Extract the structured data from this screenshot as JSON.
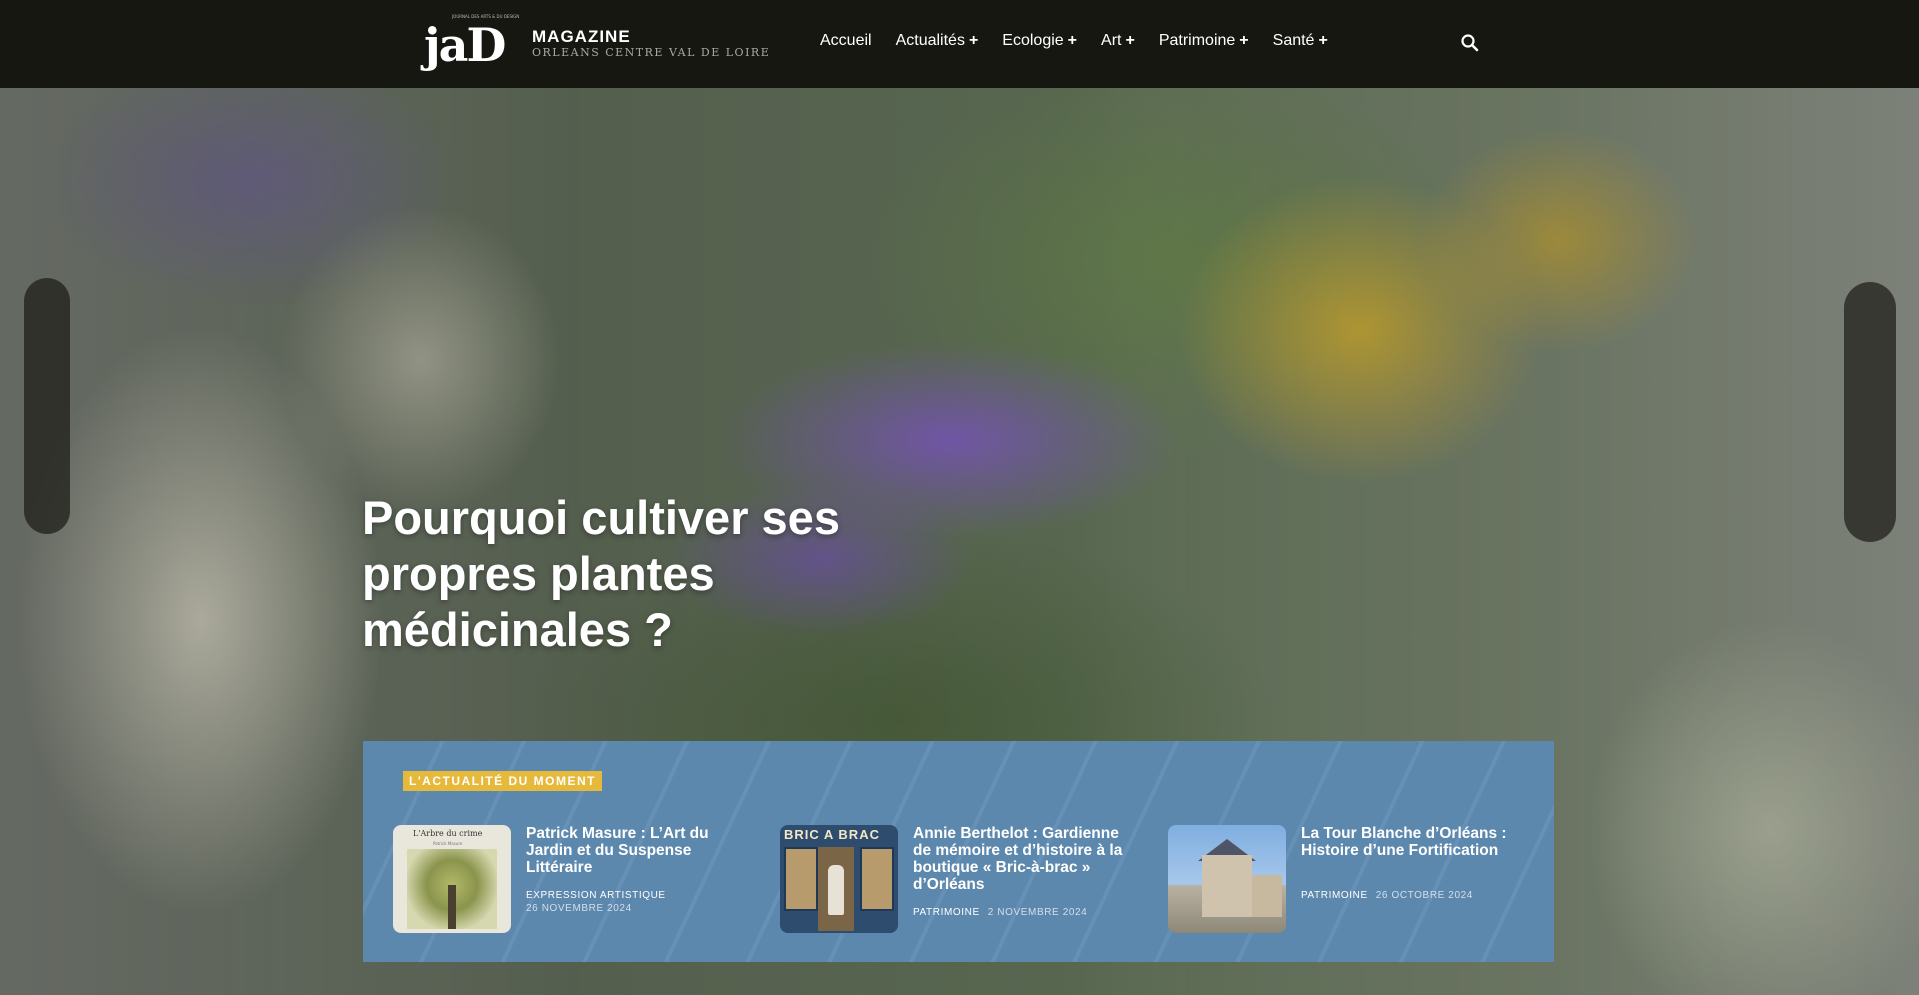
{
  "header": {
    "logo_text": "jaD",
    "logo_tiny": "JOURNAL DES ARTS & DU DESIGN",
    "magazine_title": "MAGAZINE",
    "magazine_subtitle": "ORLEANS CENTRE VAL DE LOIRE",
    "nav": [
      {
        "label": "Accueil",
        "has_submenu": false
      },
      {
        "label": "Actualités",
        "has_submenu": true
      },
      {
        "label": "Ecologie",
        "has_submenu": true
      },
      {
        "label": "Art",
        "has_submenu": true
      },
      {
        "label": "Patrimoine",
        "has_submenu": true
      },
      {
        "label": "Santé",
        "has_submenu": true
      }
    ],
    "plus_symbol": "+",
    "search_icon": "search-icon"
  },
  "hero": {
    "title": "Pourquoi cultiver ses propres plantes médicinales ?"
  },
  "featured": {
    "badge": "L'ACTUALITÉ DU MOMENT",
    "accent_color": "#e7b93b",
    "panel_color": "#5d88ae",
    "articles": [
      {
        "title": "Patrick Masure : L’Art du Jardin et du Suspense Littéraire",
        "category": "EXPRESSION ARTISTIQUE",
        "date": "26 NOVEMBRE 2024",
        "thumb_caption": "L'Arbre du crime",
        "thumb_sub": "Patrick Masure"
      },
      {
        "title": "Annie Berthelot : Gardienne de mémoire et d’histoire à la boutique « Bric-à-brac » d’Orléans",
        "category": "PATRIMOINE",
        "date": "2 NOVEMBRE 2024",
        "thumb_caption": "BRIC A BRAC"
      },
      {
        "title": "La Tour Blanche d’Orléans : Histoire d’une Fortification",
        "category": "PATRIMOINE",
        "date": "26 OCTOBRE 2024"
      }
    ]
  }
}
